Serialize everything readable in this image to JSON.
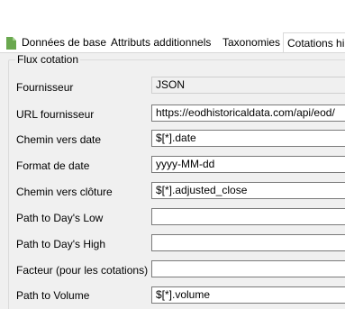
{
  "tabs": [
    {
      "label": "Données de base",
      "icon": "document-icon",
      "active": false
    },
    {
      "label": "Attributs additionnels",
      "active": false
    },
    {
      "label": "Taxonomies",
      "active": false
    },
    {
      "label": "Cotations hi",
      "active": true
    }
  ],
  "group": {
    "title": "Flux cotation",
    "rows": [
      {
        "label": "Fournisseur",
        "value": "JSON",
        "readonly": true
      },
      {
        "label": "URL fournisseur",
        "value": "https://eodhistoricaldata.com/api/eod/"
      },
      {
        "label": "Chemin vers date",
        "value": "$[*].date"
      },
      {
        "label": "Format de date",
        "value": "yyyy-MM-dd"
      },
      {
        "label": "Chemin vers clôture",
        "value": "$[*].adjusted_close"
      },
      {
        "label": "Path to Day's Low",
        "value": ""
      },
      {
        "label": "Path to Day's High",
        "value": ""
      },
      {
        "label": "Facteur (pour les cotations)",
        "value": ""
      },
      {
        "label": "Path to Volume",
        "value": "$[*].volume"
      }
    ]
  },
  "colors": {
    "icon_green": "#6aa84f",
    "panel_bg": "#f0f0f0"
  }
}
